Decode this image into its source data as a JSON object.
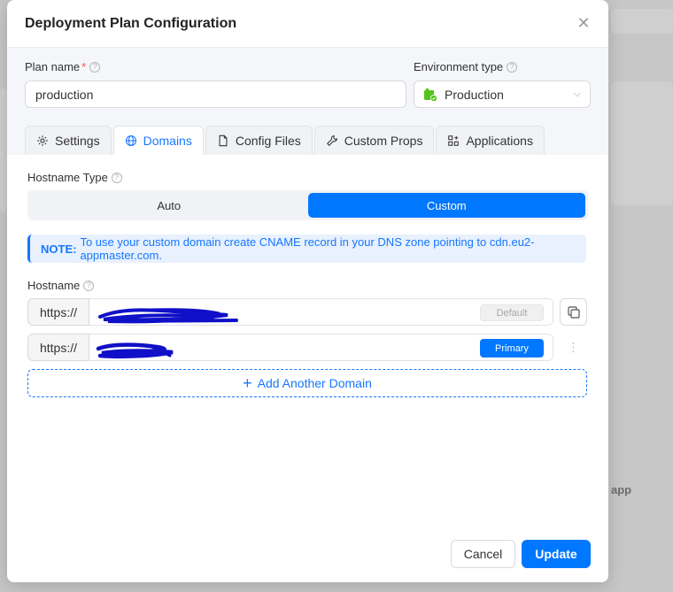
{
  "modal": {
    "title": "Deployment Plan Configuration",
    "close_icon": "close-icon"
  },
  "plan_name": {
    "label": "Plan name",
    "required_mark": "*",
    "value": "production"
  },
  "environment": {
    "label": "Environment type",
    "value": "Production",
    "icon": "environment-icon"
  },
  "tabs": [
    {
      "label": "Settings",
      "icon": "gear-icon"
    },
    {
      "label": "Domains",
      "icon": "globe-icon",
      "active": true
    },
    {
      "label": "Config Files",
      "icon": "file-icon"
    },
    {
      "label": "Custom Props",
      "icon": "wrench-icon"
    },
    {
      "label": "Applications",
      "icon": "apps-icon"
    }
  ],
  "hostname_type": {
    "label": "Hostname Type",
    "options": [
      "Auto",
      "Custom"
    ],
    "selected": "Custom"
  },
  "note": {
    "prefix": "NOTE:",
    "text": "To use your custom domain create CNAME record in your DNS zone pointing to cdn.eu2-appmaster.com."
  },
  "hostname": {
    "label": "Hostname",
    "rows": [
      {
        "prefix": "https://",
        "tag": "Default"
      },
      {
        "prefix": "https://",
        "tag": "Primary"
      }
    ]
  },
  "add_domain": {
    "label": "Add Another Domain"
  },
  "footer": {
    "cancel": "Cancel",
    "update": "Update"
  },
  "background": {
    "fragment_text": "app"
  },
  "colors": {
    "accent": "#0077ff",
    "note_bg": "#e8f1fd",
    "header_bg": "#f4f6fa"
  }
}
